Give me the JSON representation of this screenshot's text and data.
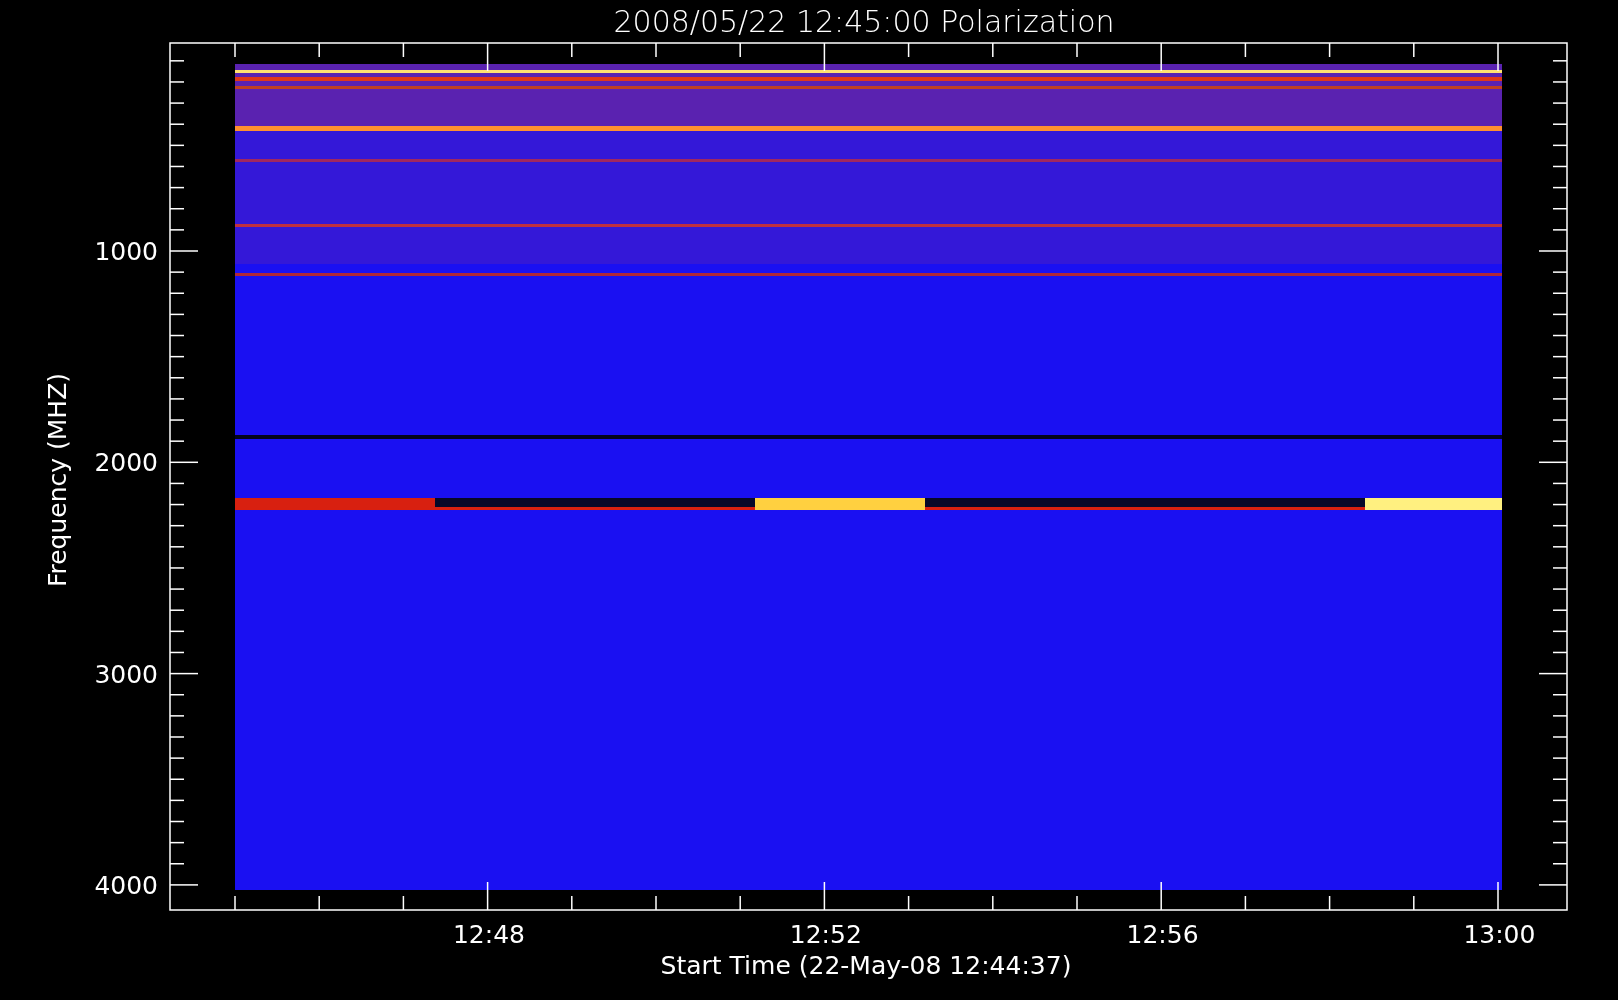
{
  "title": "2008/05/22 12:45:00 Polarization",
  "plot": {
    "ylabel": "Frequency (MHZ)",
    "xlabel": "Start Time (22-May-08 12:44:37)",
    "yticks": [
      "1000",
      "2000",
      "3000",
      "4000"
    ],
    "xticks": [
      "12:48",
      "12:52",
      "12:56",
      "13:00"
    ]
  }
}
